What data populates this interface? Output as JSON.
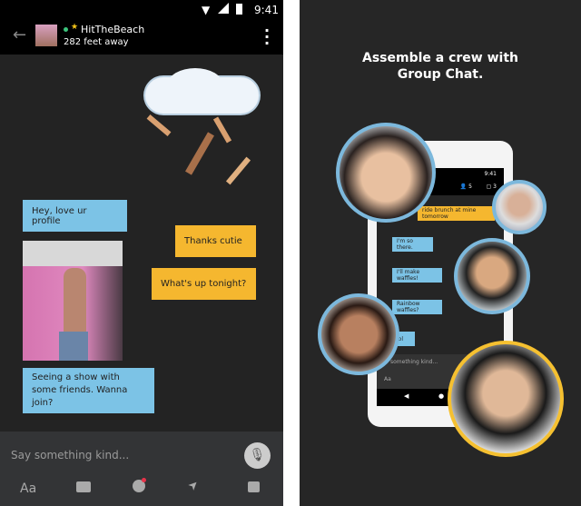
{
  "left": {
    "status": {
      "time": "9:41"
    },
    "header": {
      "name": "HitTheBeach",
      "distance": "282 feet away"
    },
    "messages": [
      {
        "text": "Hey, love ur profile",
        "side": "received"
      },
      {
        "text": "Thanks cutie",
        "side": "sent"
      },
      {
        "text": "What's up tonight?",
        "side": "sent"
      },
      {
        "text": "Seeing a show with some friends. Wanna join?",
        "side": "received"
      }
    ],
    "input": {
      "placeholder": "Say something kind..."
    },
    "toolbar": {
      "text_label": "Aa"
    }
  },
  "right": {
    "title": "Assemble a crew with Group Chat.",
    "phone": {
      "time": "9:41",
      "members": "5",
      "albums": "3",
      "messages": [
        "ride brunch at mine tomorrow",
        "I'm so there.",
        "I'll make waffles!",
        "Rainbow waffles?",
        "lol"
      ],
      "placeholder": "something kind...",
      "text_label": "Aa"
    }
  },
  "colors": {
    "received": "#7cc3e6",
    "sent": "#f5b72f",
    "online": "#3cc47c"
  }
}
